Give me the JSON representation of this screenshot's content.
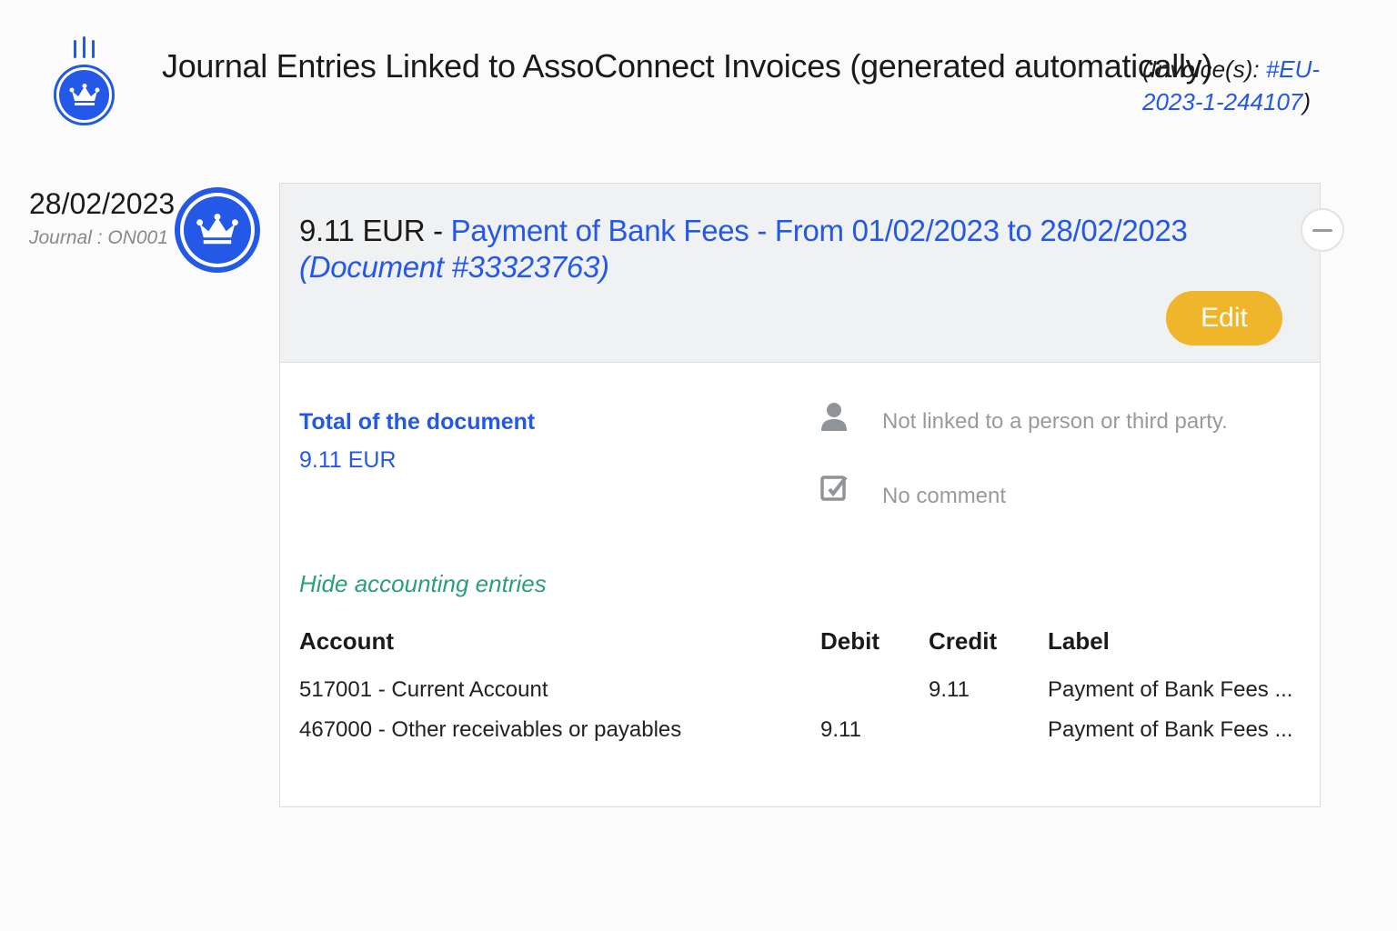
{
  "header": {
    "title": "Journal Entries Linked to AssoConnect Invoices (generated automatically)",
    "invoice_prefix": "(Invoice(s): ",
    "invoice_link": "#EU-2023-1-244107",
    "invoice_suffix": ")",
    "icon": "crown-icon"
  },
  "entry": {
    "date": "28/02/2023",
    "journal": "Journal : ON001",
    "icon": "crown-icon"
  },
  "card": {
    "amount": "9.11 EUR",
    "separator": " - ",
    "description": "Payment of Bank Fees - From 01/02/2023 to 28/02/2023",
    "document": "(Document #33323763)",
    "edit_label": "Edit",
    "collapse_icon": "minus-icon",
    "total_label": "Total of the document",
    "total_value": "9.11 EUR",
    "third_party": "Not linked to a person or third party.",
    "comment": "No comment",
    "hide_entries": "Hide accounting entries"
  },
  "table": {
    "columns": [
      "Account",
      "Debit",
      "Credit",
      "Label"
    ],
    "rows": [
      {
        "account": "517001 - Current Account",
        "debit": "",
        "credit": "9.11",
        "label": "Payment of Bank Fees ..."
      },
      {
        "account": "467000 - Other receivables or payables",
        "debit": "9.11",
        "credit": "",
        "label": "Payment of Bank Fees ..."
      }
    ]
  },
  "colors": {
    "primary": "#2458e6",
    "accent": "#f0b62b",
    "link_green": "#2aa07a"
  }
}
